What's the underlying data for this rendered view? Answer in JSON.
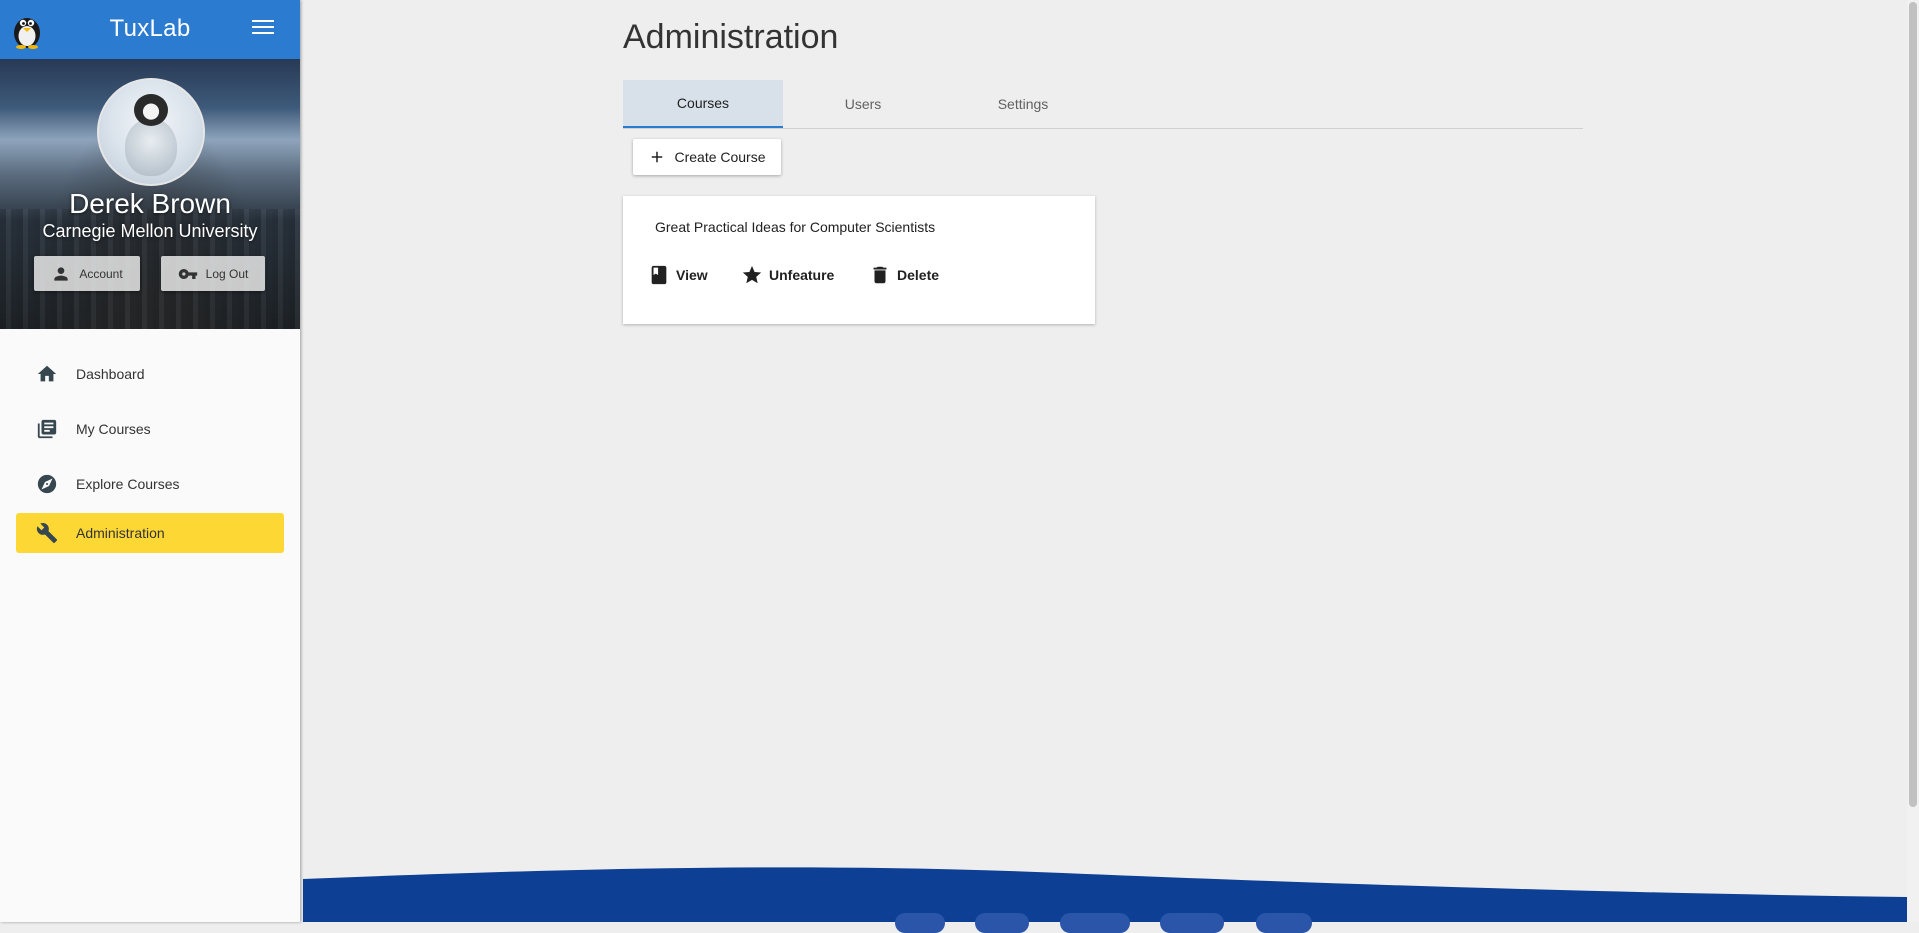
{
  "app": {
    "title": "TuxLab"
  },
  "profile": {
    "name": "Derek Brown",
    "organization": "Carnegie Mellon University",
    "account_label": "Account",
    "logout_label": "Log Out"
  },
  "nav": {
    "items": [
      {
        "label": "Dashboard",
        "icon": "home-icon"
      },
      {
        "label": "My Courses",
        "icon": "library-books-icon"
      },
      {
        "label": "Explore Courses",
        "icon": "compass-icon"
      },
      {
        "label": "Administration",
        "icon": "wrench-icon",
        "active": true
      }
    ]
  },
  "main": {
    "title": "Administration",
    "tabs": [
      {
        "label": "Courses",
        "active": true
      },
      {
        "label": "Users"
      },
      {
        "label": "Settings"
      }
    ],
    "create_label": "Create Course",
    "course": {
      "title": "Great Practical Ideas for Computer Scientists",
      "actions": {
        "view": "View",
        "unfeature": "Unfeature",
        "delete": "Delete"
      }
    }
  },
  "colors": {
    "primary": "#2b7bd0",
    "active_nav": "#fdd835",
    "footer": "#0d3f94",
    "background": "#eeeeee"
  }
}
